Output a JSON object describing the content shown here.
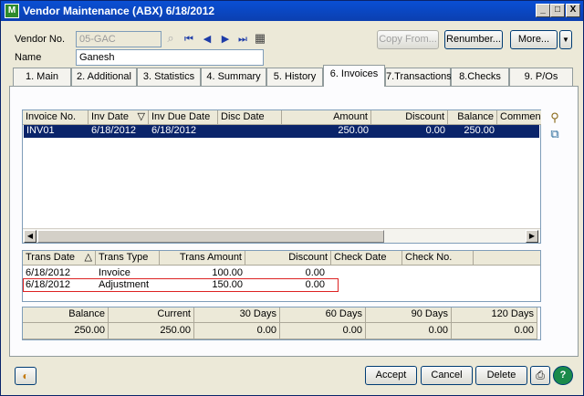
{
  "window": {
    "title": "Vendor Maintenance (ABX) 6/18/2012",
    "app_icon_text": "M",
    "controls": {
      "minimize": "_",
      "maximize": "□",
      "close": "X"
    }
  },
  "header": {
    "vendor_no_label": "Vendor No.",
    "vendor_no_value": "05-GAC",
    "name_label": "Name",
    "name_value": "Ganesh",
    "nav": {
      "first": "⏮",
      "prev": "◀",
      "next": "▶",
      "last": "⏭"
    },
    "copy_from": "Copy From...",
    "renumber": "Renumber...",
    "more": "More...",
    "more_arrow": "▼"
  },
  "tabs": [
    {
      "label": "1. Main"
    },
    {
      "label": "2. Additional"
    },
    {
      "label": "3. Statistics"
    },
    {
      "label": "4. Summary"
    },
    {
      "label": "5. History"
    },
    {
      "label": "6. Invoices"
    },
    {
      "label": "7.Transactions"
    },
    {
      "label": "8.Checks"
    },
    {
      "label": "9. P/Os"
    }
  ],
  "invoices": {
    "columns": [
      "Invoice No.",
      "Inv Date",
      "Inv Due Date",
      "Disc Date",
      "Amount",
      "Discount",
      "Balance",
      "Commen"
    ],
    "sort_glyph": "▽",
    "rows": [
      {
        "invoice_no": "INV01",
        "inv_date": "6/18/2012",
        "due_date": "6/18/2012",
        "disc_date": "",
        "amount": "250.00",
        "discount": "0.00",
        "balance": "250.00"
      }
    ]
  },
  "transactions": {
    "columns": [
      "Trans Date",
      "Trans Type",
      "Trans Amount",
      "Discount",
      "Check Date",
      "Check No."
    ],
    "sort_glyph": "△",
    "rows": [
      {
        "date": "6/18/2012",
        "type": "Invoice",
        "amount": "100.00",
        "discount": "0.00"
      },
      {
        "date": "6/18/2012",
        "type": "Adjustment",
        "amount": "150.00",
        "discount": "0.00"
      }
    ]
  },
  "aging": {
    "columns": [
      "Balance",
      "Current",
      "30 Days",
      "60 Days",
      "90 Days",
      "120 Days"
    ],
    "values": [
      "250.00",
      "250.00",
      "0.00",
      "0.00",
      "0.00",
      "0.00"
    ]
  },
  "footer": {
    "accept": "Accept",
    "cancel": "Cancel",
    "delete": "Delete"
  },
  "colors": {
    "title_bar": "#0b47c4",
    "selection": "#0a246a",
    "highlight_box": "#dd2222"
  }
}
